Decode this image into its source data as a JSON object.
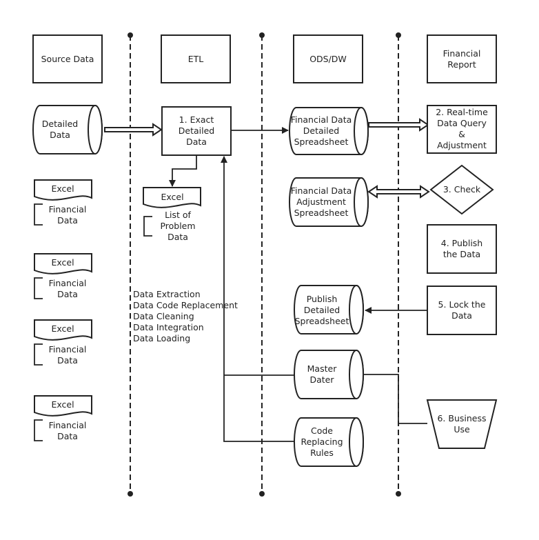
{
  "lanes": {
    "source": "Source Data",
    "etl": "ETL",
    "ods": "ODS/DW",
    "report": [
      "Financial",
      "Report"
    ]
  },
  "source": {
    "detailed": [
      "Detailed",
      "Data"
    ],
    "excel_label": "Excel",
    "financial_data": [
      "Financial",
      "Data"
    ]
  },
  "etl": {
    "step1": [
      "1. Exact",
      "Detailed",
      "Data"
    ],
    "problem_doc_label": "Excel",
    "problem_list": [
      "List of",
      "Problem",
      "Data"
    ],
    "operations": [
      "Data Extraction",
      "Data Code Replacement",
      "Data Cleaning",
      "Data Integration",
      "Data Loading"
    ]
  },
  "ods": {
    "detailed_sheet": [
      "Financial Data",
      "Detailed",
      "Spreadsheet"
    ],
    "adjust_sheet": [
      "Financial Data",
      "Adjustment",
      "Spreadsheet"
    ],
    "publish_sheet": [
      "Publish",
      "Detailed",
      "Spreadsheet"
    ],
    "master": [
      "Master",
      "Dater"
    ],
    "code_rules": [
      "Code",
      "Replacing",
      "Rules"
    ]
  },
  "report": {
    "step2": [
      "2.  Real-time",
      "Data Query",
      "&",
      "Adjustment"
    ],
    "step3": "3. Check",
    "step4": [
      "4. Publish",
      "the Data"
    ],
    "step5": [
      "5. Lock the",
      "the Data"
    ],
    "step6": [
      "6. Business",
      "Use"
    ]
  }
}
